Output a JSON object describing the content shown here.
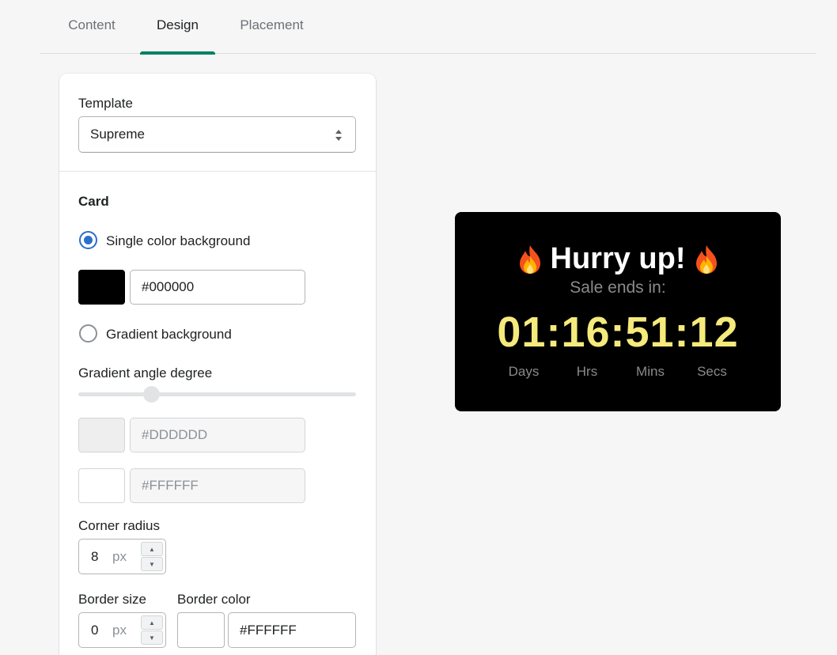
{
  "tabs": [
    {
      "label": "Content",
      "active": false
    },
    {
      "label": "Design",
      "active": true
    },
    {
      "label": "Placement",
      "active": false
    }
  ],
  "accent_color": "#008060",
  "template": {
    "label": "Template",
    "selected": "Supreme"
  },
  "card": {
    "heading": "Card",
    "single_color": {
      "label": "Single color background",
      "checked": true,
      "swatch_color": "#000000",
      "hex_value": "#000000"
    },
    "gradient": {
      "label": "Gradient background",
      "checked": false,
      "angle_label": "Gradient angle degree",
      "angle_slider_fraction": 0.26,
      "color1": {
        "swatch_color": "#EEEEEE",
        "hex_value": "#DDDDDD"
      },
      "color2": {
        "swatch_color": "#FFFFFF",
        "hex_value": "#FFFFFF"
      }
    },
    "corner_radius": {
      "label": "Corner radius",
      "value": "8",
      "unit": "px"
    },
    "border_size": {
      "label": "Border size",
      "value": "0",
      "unit": "px"
    },
    "border_color": {
      "label": "Border color",
      "swatch_color": "#FFFFFF",
      "hex_value": "#FFFFFF"
    }
  },
  "preview": {
    "title": "Hurry up!",
    "icon": "fire-icon",
    "subtitle": "Sale ends in:",
    "timer": "01:16:51:12",
    "timer_color": "#F5EA7B",
    "background_color": "#000000",
    "units": [
      "Days",
      "Hrs",
      "Mins",
      "Secs"
    ]
  }
}
